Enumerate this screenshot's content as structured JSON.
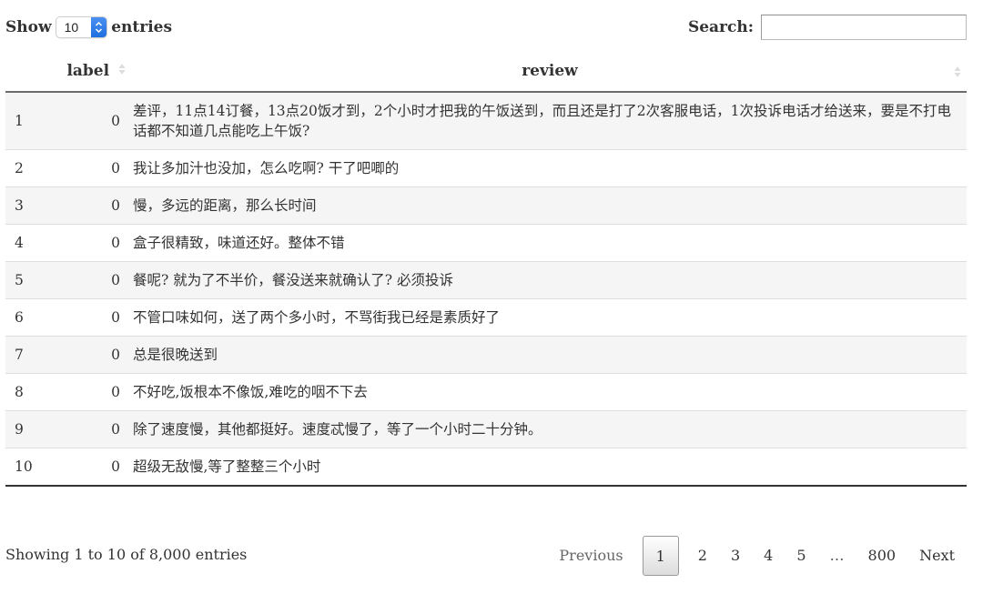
{
  "length_menu": {
    "prefix": "Show",
    "selected": "10",
    "suffix": "entries",
    "accent_color": "#2f7cf0"
  },
  "search": {
    "label": "Search:",
    "value": "",
    "placeholder": ""
  },
  "table": {
    "columns": [
      {
        "key": "index",
        "label": ""
      },
      {
        "key": "label",
        "label": "label"
      },
      {
        "key": "review",
        "label": "review"
      }
    ],
    "rows": [
      {
        "index": "1",
        "label": "0",
        "review": "差评，11点14订餐，13点20饭才到，2个小时才把我的午饭送到，而且还是打了2次客服电话，1次投诉电话才给送来，要是不打电话都不知道几点能吃上午饭?"
      },
      {
        "index": "2",
        "label": "0",
        "review": "我让多加汁也没加，怎么吃啊? 干了吧唧的"
      },
      {
        "index": "3",
        "label": "0",
        "review": "慢，多远的距离，那么长时间"
      },
      {
        "index": "4",
        "label": "0",
        "review": "盒子很精致，味道还好。整体不错"
      },
      {
        "index": "5",
        "label": "0",
        "review": "餐呢? 就为了不半价，餐没送来就确认了? 必须投诉"
      },
      {
        "index": "6",
        "label": "0",
        "review": "不管口味如何，送了两个多小时，不骂街我已经是素质好了"
      },
      {
        "index": "7",
        "label": "0",
        "review": "总是很晚送到"
      },
      {
        "index": "8",
        "label": "0",
        "review": "不好吃,饭根本不像饭,难吃的咽不下去"
      },
      {
        "index": "9",
        "label": "0",
        "review": "除了速度慢，其他都挺好。速度忒慢了，等了一个小时二十分钟。"
      },
      {
        "index": "10",
        "label": "0",
        "review": "超级无敌慢,等了整整三个小时"
      }
    ]
  },
  "footer": {
    "info": "Showing 1 to 10 of 8,000 entries"
  },
  "pagination": {
    "previous": "Previous",
    "pages": [
      "1",
      "2",
      "3",
      "4",
      "5",
      "…",
      "800"
    ],
    "current": "1",
    "next": "Next"
  }
}
